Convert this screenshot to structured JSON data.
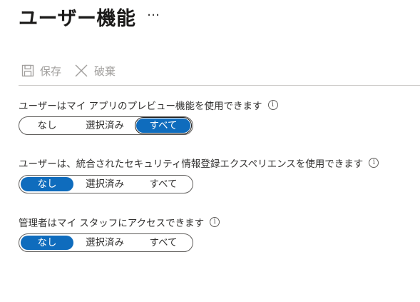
{
  "page": {
    "title": "ユーザー機能",
    "more_label": "…"
  },
  "toolbar": {
    "save_label": "保存",
    "discard_label": "破棄"
  },
  "settings": [
    {
      "label": "ユーザーはマイ アプリのプレビュー機能を使用できます",
      "info": "i",
      "options": [
        "なし",
        "選択済み",
        "すべて"
      ],
      "selected": "すべて"
    },
    {
      "label": "ユーザーは、統合されたセキュリティ情報登録エクスペリエンスを使用できます",
      "info": "i",
      "options": [
        "なし",
        "選択済み",
        "すべて"
      ],
      "selected": "なし"
    },
    {
      "label": "管理者はマイ スタッフにアクセスできます",
      "info": "i",
      "options": [
        "なし",
        "選択済み",
        "すべて"
      ],
      "selected": "なし"
    }
  ],
  "colors": {
    "accent": "#0f6cbd",
    "disabled_text": "#a19f9d",
    "border": "#605e5c"
  }
}
